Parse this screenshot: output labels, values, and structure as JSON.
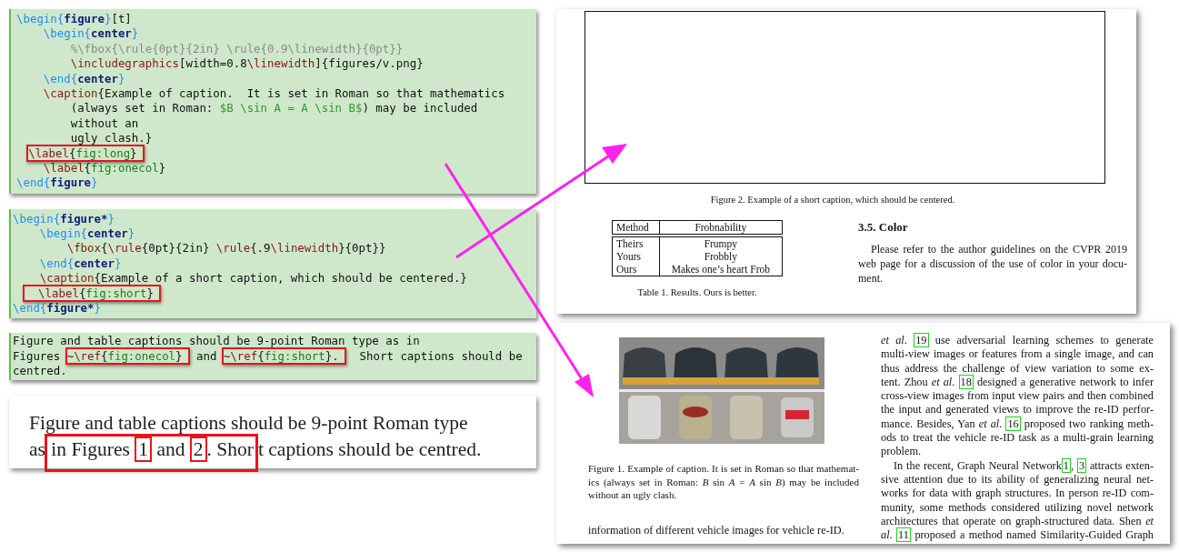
{
  "code_panels": [
    {
      "lines": [
        [
          {
            "text": "\\begin{",
            "kind": "keyword"
          },
          {
            "text": "figure",
            "kind": "env"
          },
          {
            "text": "}",
            "kind": "keyword"
          },
          {
            "text": "[t]",
            "kind": "text"
          }
        ],
        [
          {
            "text": "    \\begin{",
            "kind": "keyword"
          },
          {
            "text": "center",
            "kind": "env"
          },
          {
            "text": "}",
            "kind": "keyword"
          }
        ],
        [
          {
            "text": "        %\\fbox{\\rule{0pt}{2in} \\rule{0.9\\linewidth}{0pt}}",
            "kind": "comment"
          }
        ],
        [
          {
            "text": "        \\includegraphics",
            "kind": "macro"
          },
          {
            "text": "[width=0.8",
            "kind": "text"
          },
          {
            "text": "\\linewidth",
            "kind": "macro"
          },
          {
            "text": "]{figures/v.png}",
            "kind": "text"
          }
        ],
        [
          {
            "text": "    \\end{",
            "kind": "keyword"
          },
          {
            "text": "center",
            "kind": "env"
          },
          {
            "text": "}",
            "kind": "keyword"
          }
        ],
        [
          {
            "text": "    \\caption",
            "kind": "macro"
          },
          {
            "text": "{Example of caption.  It is set in Roman so that mathematics",
            "kind": "text"
          }
        ],
        [
          {
            "text": "        (always set in Roman: ",
            "kind": "text"
          },
          {
            "text": "$B \\sin A = A \\sin B$",
            "kind": "math"
          },
          {
            "text": ") may be included",
            "kind": "text"
          }
        ],
        [
          {
            "text": "        without an",
            "kind": "text"
          }
        ],
        [
          {
            "text": "        ugly clash.}",
            "kind": "text"
          }
        ],
        [
          {
            "kind": "box",
            "items": [
              {
                "text": "\\label",
                "kind": "macro"
              },
              {
                "text": "{",
                "kind": "text"
              },
              {
                "text": "fig:long",
                "kind": "label"
              },
              {
                "text": "}",
                "kind": "text"
              }
            ]
          }
        ],
        [
          {
            "text": "    \\label",
            "kind": "macro"
          },
          {
            "text": "{",
            "kind": "text"
          },
          {
            "text": "fig:onecol",
            "kind": "label"
          },
          {
            "text": "}",
            "kind": "text"
          }
        ],
        [
          {
            "text": "\\end{",
            "kind": "keyword"
          },
          {
            "text": "figure",
            "kind": "env"
          },
          {
            "text": "}",
            "kind": "keyword"
          }
        ]
      ]
    },
    {
      "lines": [
        [
          {
            "text": "\\begin{",
            "kind": "keyword"
          },
          {
            "text": "figure*",
            "kind": "env"
          },
          {
            "text": "}",
            "kind": "keyword"
          }
        ],
        [
          {
            "text": "    \\begin{",
            "kind": "keyword"
          },
          {
            "text": "center",
            "kind": "env"
          },
          {
            "text": "}",
            "kind": "keyword"
          }
        ],
        [
          {
            "text": "        \\fbox",
            "kind": "macro"
          },
          {
            "text": "{",
            "kind": "text"
          },
          {
            "text": "\\rule",
            "kind": "macro"
          },
          {
            "text": "{0pt}{2in} ",
            "kind": "text"
          },
          {
            "text": "\\rule",
            "kind": "macro"
          },
          {
            "text": "{.9",
            "kind": "text"
          },
          {
            "text": "\\linewidth",
            "kind": "macro"
          },
          {
            "text": "}{0pt}}",
            "kind": "text"
          }
        ],
        [
          {
            "text": "    \\end{",
            "kind": "keyword"
          },
          {
            "text": "center",
            "kind": "env"
          },
          {
            "text": "}",
            "kind": "keyword"
          }
        ],
        [
          {
            "text": "    \\caption",
            "kind": "macro"
          },
          {
            "text": "{Example of a short caption, which should be centered.}",
            "kind": "text"
          }
        ],
        [
          {
            "kind": "box",
            "items": [
              {
                "text": "  \\label",
                "kind": "macro"
              },
              {
                "text": "{",
                "kind": "text"
              },
              {
                "text": "fig:short",
                "kind": "label"
              },
              {
                "text": "}",
                "kind": "text"
              }
            ]
          }
        ],
        [
          {
            "text": "\\end{",
            "kind": "keyword"
          },
          {
            "text": "figure*",
            "kind": "env"
          },
          {
            "text": "}",
            "kind": "keyword"
          }
        ]
      ]
    },
    {
      "lines": [
        [
          {
            "text": "Figure and table captions should be 9-point Roman type as in",
            "kind": "text"
          }
        ],
        [
          {
            "text": "Figures ",
            "kind": "text"
          },
          {
            "kind": "box",
            "items": [
              {
                "text": "~",
                "kind": "text"
              },
              {
                "text": "\\ref",
                "kind": "macro"
              },
              {
                "text": "{",
                "kind": "text"
              },
              {
                "text": "fig:onecol",
                "kind": "label"
              },
              {
                "text": "}",
                "kind": "text"
              }
            ]
          },
          {
            "text": " and ",
            "kind": "text"
          },
          {
            "kind": "box",
            "items": [
              {
                "text": "~",
                "kind": "text"
              },
              {
                "text": "\\ref",
                "kind": "macro"
              },
              {
                "text": "{",
                "kind": "text"
              },
              {
                "text": "fig:short",
                "kind": "label"
              },
              {
                "text": "}.",
                "kind": "text"
              }
            ]
          },
          {
            "text": "  Short captions should be",
            "kind": "text"
          }
        ],
        [
          {
            "text": "centred.",
            "kind": "text"
          }
        ]
      ]
    }
  ],
  "rendered_snippet": {
    "lines": [
      [
        {
          "text": "Figure and table captions should be 9-point Roman type",
          "kind": "text"
        }
      ],
      [
        {
          "text": "as ",
          "kind": "text"
        },
        {
          "kind": "box",
          "items": [
            {
              "text": "in Figures ",
              "kind": "text"
            },
            {
              "text": "1",
              "kind": "ref"
            },
            {
              "text": " and ",
              "kind": "text"
            },
            {
              "text": "2",
              "kind": "ref"
            },
            {
              "text": ". Shor",
              "kind": "text"
            }
          ]
        },
        {
          "text": "t captions should be centred.",
          "kind": "text"
        }
      ]
    ]
  },
  "page_1": {
    "figure_caption": "Figure 2. Example of a short caption, which should be centered.",
    "table": {
      "columns": [
        "Method",
        "Frobnability"
      ],
      "rows": [
        [
          "Theirs",
          "Frumpy"
        ],
        [
          "Yours",
          "Frobbly"
        ],
        [
          "Ours",
          "Makes one’s heart Frob"
        ]
      ],
      "caption": "Table 1. Results. Ours is better."
    },
    "section": {
      "heading": "3.5. Color",
      "lines": [
        "Please refer to the author guidelines on the CVPR 2019",
        "web page for a discussion of the use of color in your docu-",
        "ment."
      ]
    }
  },
  "page_2": {
    "figure": {
      "kind": "picture"
    },
    "caption_lines": [
      "Figure 1. Example of caption. It is set in Roman so that mathemat-",
      "ics (always set in Roman: *B* sin *A* = *A* sin *B*) may be included",
      "without an ugly clash."
    ],
    "left_text": "information of different vehicle images for vehicle re-ID.",
    "paragraphs": [
      {
        "indented": false,
        "lines": [
          [
            {
              "text": "et al",
              "kind": "italic"
            },
            {
              "text": ". ",
              "kind": "text"
            },
            {
              "text": "19",
              "kind": "cite"
            },
            {
              "text": " use adversarial learning schemes to generate",
              "kind": "text"
            }
          ],
          [
            {
              "text": "multi-view images or features from a single image, and can",
              "kind": "text"
            }
          ],
          [
            {
              "text": "thus address the challenge of view variation to some ex-",
              "kind": "text"
            }
          ],
          [
            {
              "text": "tent. Zhou ",
              "kind": "text"
            },
            {
              "text": "et al",
              "kind": "italic"
            },
            {
              "text": ". ",
              "kind": "text"
            },
            {
              "text": "18",
              "kind": "cite"
            },
            {
              "text": " designed a generative network to infer",
              "kind": "text"
            }
          ],
          [
            {
              "text": "cross-view images from input view pairs and then combined",
              "kind": "text"
            }
          ],
          [
            {
              "text": "the input and generated views to improve the re-ID perfor-",
              "kind": "text"
            }
          ],
          [
            {
              "text": "mance. Besides, Yan ",
              "kind": "text"
            },
            {
              "text": "et al",
              "kind": "italic"
            },
            {
              "text": ". ",
              "kind": "text"
            },
            {
              "text": "16",
              "kind": "cite"
            },
            {
              "text": " proposed two ranking meth-",
              "kind": "text"
            }
          ],
          [
            {
              "text": "ods to treat the vehicle re-ID task as a multi-grain learning",
              "kind": "text"
            }
          ],
          [
            {
              "text": "problem.",
              "kind": "text"
            }
          ]
        ]
      },
      {
        "indented": true,
        "lines": [
          [
            {
              "text": "In the recent, Graph Neural Network",
              "kind": "text"
            },
            {
              "text": "1",
              "kind": "cite"
            },
            {
              "text": ", ",
              "kind": "text"
            },
            {
              "text": "3",
              "kind": "cite"
            },
            {
              "text": " attracts exten-",
              "kind": "text"
            }
          ],
          [
            {
              "text": "sive attention due to its ability of generalizing neural net-",
              "kind": "text"
            }
          ],
          [
            {
              "text": "works for data with graph structures. In person re-ID com-",
              "kind": "text"
            }
          ],
          [
            {
              "text": "munity, some methods considered utilizing novel network",
              "kind": "text"
            }
          ],
          [
            {
              "text": "architectures that operate on graph-structured data. Shen ",
              "kind": "text"
            },
            {
              "text": "et",
              "kind": "italic"
            }
          ],
          [
            {
              "text": "al",
              "kind": "italic"
            },
            {
              "text": ". ",
              "kind": "text"
            },
            {
              "text": "11",
              "kind": "cite"
            },
            {
              "text": " proposed a method named Similarity-Guided Graph",
              "kind": "text"
            }
          ]
        ]
      }
    ]
  }
}
